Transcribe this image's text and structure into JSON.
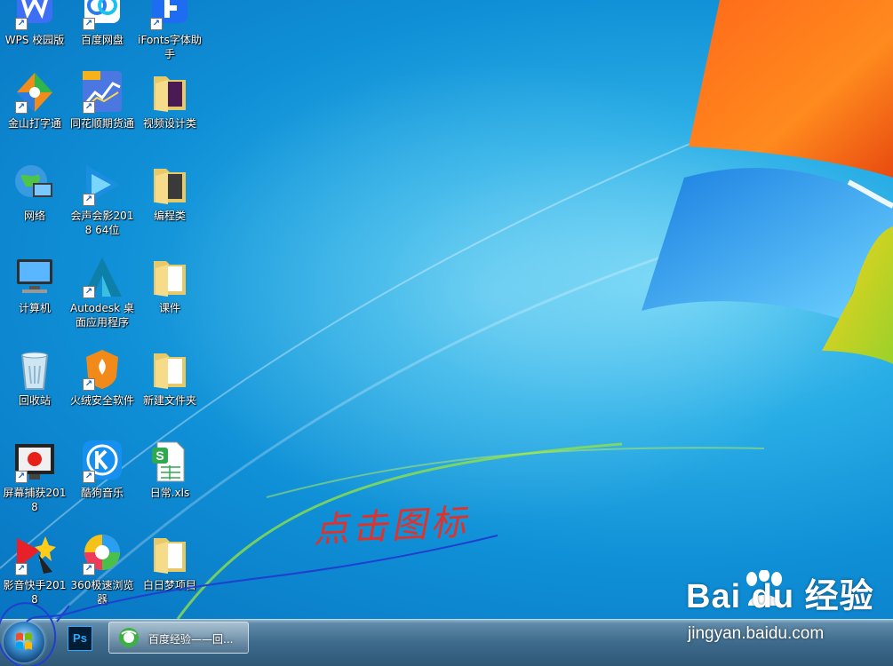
{
  "desktop_icons": [
    {
      "id": "wps",
      "label": "WPS 校园版",
      "icon": "wps-icon",
      "shortcut": true
    },
    {
      "id": "baidu-netdisk",
      "label": "百度网盘",
      "icon": "cloud-disk-icon",
      "shortcut": true
    },
    {
      "id": "ifonts",
      "label": "iFonts字体助手",
      "icon": "ifonts-icon",
      "shortcut": true
    },
    {
      "id": "jinshan",
      "label": "金山打字通",
      "icon": "typing-icon",
      "shortcut": true
    },
    {
      "id": "tonghuashun",
      "label": "同花顺期货通",
      "icon": "stock-chart-icon",
      "shortcut": true
    },
    {
      "id": "video-design",
      "label": "视频设计类",
      "icon": "folder-icon",
      "shortcut": false
    },
    {
      "id": "network",
      "label": "网络",
      "icon": "network-globe-icon",
      "shortcut": false
    },
    {
      "id": "huisheng",
      "label": "会声会影2018 64位",
      "icon": "video-editor-icon",
      "shortcut": true
    },
    {
      "id": "programming",
      "label": "编程类",
      "icon": "folder-icon",
      "shortcut": false
    },
    {
      "id": "computer",
      "label": "计算机",
      "icon": "computer-icon",
      "shortcut": false
    },
    {
      "id": "autodesk",
      "label": "Autodesk 桌面应用程序",
      "icon": "autodesk-icon",
      "shortcut": true
    },
    {
      "id": "courseware",
      "label": "课件",
      "icon": "folder-icon",
      "shortcut": false
    },
    {
      "id": "recycle",
      "label": "回收站",
      "icon": "recycle-bin-icon",
      "shortcut": false
    },
    {
      "id": "huorong",
      "label": "火绒安全软件",
      "icon": "shield-icon",
      "shortcut": true
    },
    {
      "id": "new-folder",
      "label": "新建文件夹",
      "icon": "folder-icon",
      "shortcut": false
    },
    {
      "id": "screen-capture",
      "label": "屏幕捕获2018",
      "icon": "screen-record-icon",
      "shortcut": true
    },
    {
      "id": "kugou",
      "label": "酷狗音乐",
      "icon": "kugou-icon",
      "shortcut": true
    },
    {
      "id": "richang",
      "label": "日常.xls",
      "icon": "spreadsheet-icon",
      "shortcut": false
    },
    {
      "id": "yingyin",
      "label": "影音快手2018",
      "icon": "media-star-icon",
      "shortcut": true
    },
    {
      "id": "browser360",
      "label": "360极速浏览器",
      "icon": "browser-360-icon",
      "shortcut": true
    },
    {
      "id": "bairimeng",
      "label": "白日梦项目",
      "icon": "folder-icon",
      "shortcut": false
    }
  ],
  "taskbar": {
    "start_icon": "windows-orb-icon",
    "pinned": [
      {
        "label": "Ps",
        "icon": "photoshop-icon"
      }
    ],
    "tasks": [
      {
        "label": "百度经验——回...",
        "icon": "browser-360-icon"
      }
    ]
  },
  "annotation": {
    "text": "点击图标",
    "color": "#e0322a",
    "underline_color": "#1f3fd0"
  },
  "watermark": {
    "logo": "Bai du 经验",
    "url": "jingyan.baidu.com"
  }
}
